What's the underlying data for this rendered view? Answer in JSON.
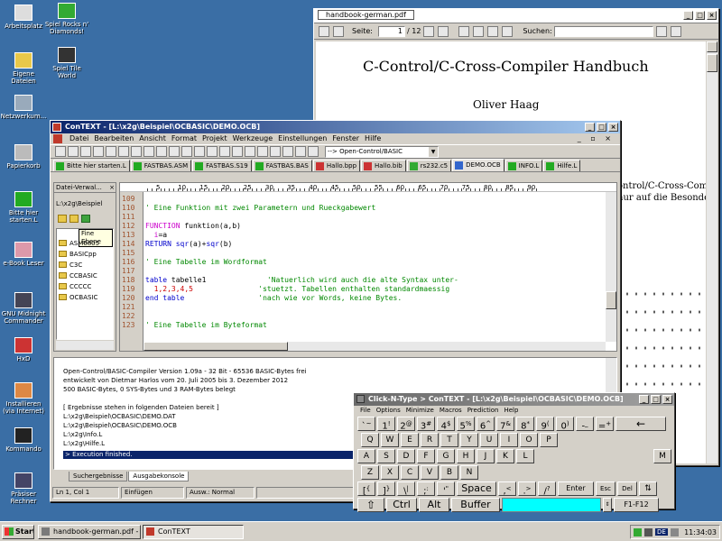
{
  "desktop": {
    "icons": [
      {
        "label": "Arbeitsplatz"
      },
      {
        "label": "Eigene Dateien"
      },
      {
        "label": "Netzwerkum..."
      },
      {
        "label": "Papierkorb"
      },
      {
        "label": "Bitte hier starten.L"
      },
      {
        "label": "e-Book Leser"
      },
      {
        "label": "GNU Midnight Commander"
      },
      {
        "label": "HxD"
      },
      {
        "label": "Installieren (via Internet)"
      },
      {
        "label": "Kommando"
      },
      {
        "label": "Präsiser Rechner"
      },
      {
        "label": "Spiel Rocks n' Diamonds!"
      },
      {
        "label": "Spiel Tile World"
      }
    ]
  },
  "pdf": {
    "title": "handbook-german.pdf",
    "page_label": "Seite:",
    "page_value": "1",
    "page_total": "/ 12",
    "search_label": "Suchen:",
    "heading": "C-Control/C-Cross-Compiler Handbuch",
    "author": "Oliver Haag",
    "side_text_1": "ontrol/C-Cross-Compil",
    "side_text_2": "nur auf die Besonde"
  },
  "context": {
    "title": "ConTEXT - [L:\\x2g\\Beispiel\\OCBASIC\\DEMO.OCB]",
    "menu": [
      "Datei",
      "Bearbeiten",
      "Ansicht",
      "Format",
      "Projekt",
      "Werkzeuge",
      "Einstellungen",
      "Fenster",
      "Hilfe"
    ],
    "highlighter": "--> Open-Control/BASIC",
    "tabs": [
      "Bitte hier starten.L",
      "FASTBAS.ASM",
      "FASTBAS.S19",
      "FASTBAS.BAS",
      "Hallo.bpp",
      "Hallo.bib",
      "rs232.c5",
      "DEMO.OCB",
      "INFO.L",
      "Hilfe.L"
    ],
    "file_panel": {
      "title": "Datei-Verwal...",
      "path": "L:\\x2g\\Beispiel",
      "tooltip": "Fine Ebene",
      "folders": [
        "ASM6805",
        "BASICpp",
        "C3C",
        "CCBASIC",
        "CCCCC",
        "OCBASIC"
      ]
    },
    "ruler": [
      "5",
      "10",
      "15",
      "20",
      "25",
      "30",
      "35",
      "40",
      "45",
      "50",
      "55",
      "60",
      "65",
      "70",
      "75",
      "80",
      "85",
      "90"
    ],
    "code_lines": [
      {
        "n": "109",
        "parts": [
          [
            "cm",
            ""
          ]
        ]
      },
      {
        "n": "110",
        "parts": [
          [
            "cm",
            "' Eine Funktion mit zwei Parametern und Rueckgabewert"
          ]
        ]
      },
      {
        "n": "111",
        "parts": [
          [
            "cm",
            ""
          ]
        ]
      },
      {
        "n": "112",
        "parts": [
          [
            "kw2",
            "FUNCTION"
          ],
          [
            "txt",
            " funktion(a,b)"
          ]
        ]
      },
      {
        "n": "113",
        "parts": [
          [
            "txt",
            "  "
          ],
          [
            "kw2",
            "i"
          ],
          [
            "txt",
            "=a"
          ]
        ]
      },
      {
        "n": "114",
        "parts": [
          [
            "kw",
            "RETURN"
          ],
          [
            "txt",
            " "
          ],
          [
            "kw",
            "sqr"
          ],
          [
            "txt",
            "(a)+"
          ],
          [
            "kw",
            "sqr"
          ],
          [
            "txt",
            "(b)"
          ]
        ]
      },
      {
        "n": "115",
        "parts": [
          [
            "cm",
            ""
          ]
        ]
      },
      {
        "n": "116",
        "parts": [
          [
            "cm",
            "' Eine Tabelle im Wordformat"
          ]
        ]
      },
      {
        "n": "117",
        "parts": [
          [
            "cm",
            ""
          ]
        ]
      },
      {
        "n": "118",
        "parts": [
          [
            "kw",
            "table"
          ],
          [
            "txt",
            " tabelle1              "
          ],
          [
            "cm",
            "'Natuerlich wird auch die alte Syntax unter-"
          ]
        ]
      },
      {
        "n": "119",
        "parts": [
          [
            "txt",
            "  "
          ],
          [
            "num",
            "1,2,3,4,5"
          ],
          [
            "txt",
            "               "
          ],
          [
            "cm",
            "'stuetzt. Tabellen enthalten standardmaessig"
          ]
        ]
      },
      {
        "n": "120",
        "parts": [
          [
            "kw",
            "end table"
          ],
          [
            "txt",
            "                 "
          ],
          [
            "cm",
            "'nach wie vor Words, keine Bytes."
          ]
        ]
      },
      {
        "n": "121",
        "parts": [
          [
            "cm",
            ""
          ]
        ]
      },
      {
        "n": "122",
        "parts": [
          [
            "cm",
            ""
          ]
        ]
      },
      {
        "n": "123",
        "parts": [
          [
            "cm",
            "' Eine Tabelle im Byteformat"
          ]
        ]
      }
    ],
    "output_lines": [
      "Open-Control/BASIC-Compiler Version 1.09a - 32 Bit - 65536 BASIC-Bytes frei",
      "entwickelt von Dietmar Harlos vom 20. Juli 2005 bis 3. Dezember 2012",
      "500 BASIC-Bytes, 0 SYS-Bytes und 3 RAM-Bytes belegt",
      "",
      "[ Ergebnisse stehen in folgenden Dateien bereit ]",
      "L:\\x2g\\Beispiel\\OCBASIC\\DEMO.DAT",
      "L:\\x2g\\Beispiel\\OCBASIC\\DEMO.OCB",
      "L:\\x2g\\Info.L",
      "L:\\x2g\\Hilfe.L"
    ],
    "output_status": "> Execution finished.",
    "bottom_tabs": [
      "Suchergebnisse",
      "Ausgabekonsole"
    ],
    "status": [
      "Ln 1, Col 1",
      "Einfügen",
      "Ausw.: Normal"
    ]
  },
  "keyboard": {
    "title": "Click-N-Type > ConTEXT - [L:\\x2g\\Beispiel\\OCBASIC\\DEMO.OCB]",
    "menu": [
      "File",
      "Options",
      "Minimize",
      "Macros",
      "Prediction",
      "Help"
    ],
    "row1": [
      [
        "~",
        "`"
      ],
      [
        "!",
        "1"
      ],
      [
        "@",
        "2"
      ],
      [
        "#",
        "3"
      ],
      [
        "$",
        "4"
      ],
      [
        "%",
        "5"
      ],
      [
        "^",
        "6"
      ],
      [
        "&",
        "7"
      ],
      [
        "*",
        "8"
      ],
      [
        "(",
        "9"
      ],
      [
        ")",
        "0"
      ],
      [
        "_",
        "-"
      ],
      [
        "+",
        "="
      ]
    ],
    "backspace": "←",
    "row2": [
      "Q",
      "W",
      "E",
      "R",
      "T",
      "Y",
      "U",
      "I",
      "O",
      "P"
    ],
    "row3": [
      "A",
      "S",
      "D",
      "F",
      "G",
      "H",
      "J",
      "K",
      "L",
      "M"
    ],
    "row4": [
      "Z",
      "X",
      "C",
      "V",
      "B",
      "N"
    ],
    "row5": [
      [
        "{",
        "["
      ],
      [
        "}",
        "]"
      ],
      [
        "|",
        "\\"
      ],
      [
        ":",
        ";"
      ],
      [
        "\"",
        "'"
      ]
    ],
    "space": "Space",
    "row5b": [
      [
        "<",
        ","
      ],
      [
        ">",
        "."
      ],
      [
        "?",
        "/"
      ]
    ],
    "enter": "Enter",
    "esc": "Esc",
    "del": "Del",
    "shift": "⇧",
    "ctrl": "Ctrl",
    "alt": "Alt",
    "buffer": "Buffer",
    "fkeys": "F1-F12"
  },
  "taskbar": {
    "start": "Start",
    "tasks": [
      "handbook-german.pdf - [C...",
      "ConTEXT"
    ],
    "lang": "DE",
    "clock": "11:34:03"
  },
  "colors": {
    "desktop": "#3a6ea5",
    "title_active": "#0a246a",
    "buffer": "#00ffff"
  }
}
